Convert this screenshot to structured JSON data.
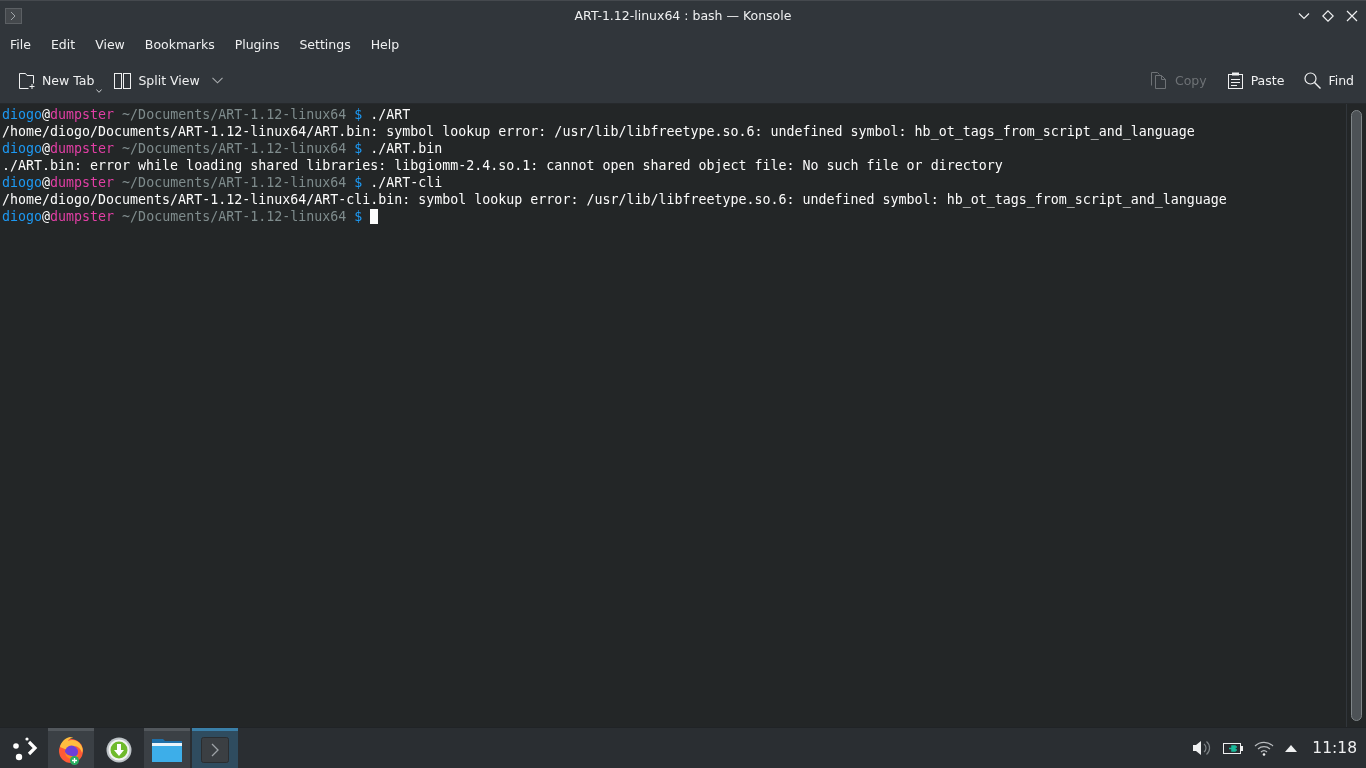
{
  "window": {
    "title": "ART-1.12-linux64 : bash — Konsole"
  },
  "menu": [
    "File",
    "Edit",
    "View",
    "Bookmarks",
    "Plugins",
    "Settings",
    "Help"
  ],
  "toolbar": {
    "left": [
      {
        "kind": "newtab",
        "label": "New Tab",
        "disabled": false,
        "menu": true
      },
      {
        "kind": "split",
        "label": "Split View",
        "disabled": false,
        "menu": true
      }
    ],
    "right": [
      {
        "kind": "copy",
        "label": "Copy",
        "disabled": true,
        "menu": false
      },
      {
        "kind": "paste",
        "label": "Paste",
        "disabled": false,
        "menu": false
      },
      {
        "kind": "find",
        "label": "Find",
        "disabled": false,
        "menu": false
      }
    ]
  },
  "terminal": {
    "lines": [
      {
        "kind": "prompt",
        "user": "diogo",
        "at": "@",
        "host": "dumpster",
        "path": "~/Documents/ART-1.12-linux64",
        "symbol": "$",
        "command": "./ART",
        "cursor": false
      },
      {
        "kind": "output",
        "text": "/home/diogo/Documents/ART-1.12-linux64/ART.bin: symbol lookup error: /usr/lib/libfreetype.so.6: undefined symbol: hb_ot_tags_from_script_and_language"
      },
      {
        "kind": "prompt",
        "user": "diogo",
        "at": "@",
        "host": "dumpster",
        "path": "~/Documents/ART-1.12-linux64",
        "symbol": "$",
        "command": "./ART.bin",
        "cursor": false
      },
      {
        "kind": "output",
        "text": "./ART.bin: error while loading shared libraries: libgiomm-2.4.so.1: cannot open shared object file: No such file or directory"
      },
      {
        "kind": "prompt",
        "user": "diogo",
        "at": "@",
        "host": "dumpster",
        "path": "~/Documents/ART-1.12-linux64",
        "symbol": "$",
        "command": "./ART-cli",
        "cursor": false
      },
      {
        "kind": "output",
        "text": "/home/diogo/Documents/ART-1.12-linux64/ART-cli.bin: symbol lookup error: /usr/lib/libfreetype.so.6: undefined symbol: hb_ot_tags_from_script_and_language"
      },
      {
        "kind": "prompt",
        "user": "diogo",
        "at": "@",
        "host": "dumpster",
        "path": "~/Documents/ART-1.12-linux64",
        "symbol": "$",
        "cursor": true
      }
    ]
  },
  "taskbar": {
    "tasks": [
      {
        "kind": "browser",
        "running": true,
        "selected": false
      },
      {
        "kind": "download",
        "running": false,
        "selected": false
      },
      {
        "kind": "files",
        "running": true,
        "selected": false
      },
      {
        "kind": "terminal",
        "running": true,
        "selected": true
      }
    ],
    "clock": "11:18"
  }
}
